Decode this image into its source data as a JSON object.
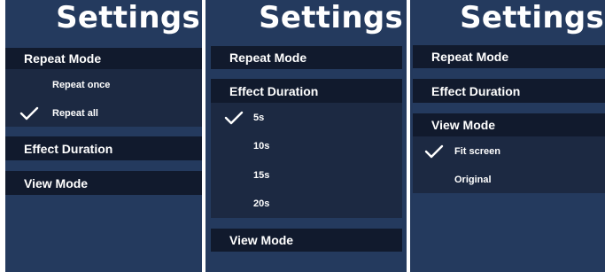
{
  "panels": [
    {
      "title": "Settings",
      "sections": {
        "repeat_mode": "Repeat Mode",
        "effect_duration": "Effect Duration",
        "view_mode": "View Mode"
      },
      "options": [
        {
          "label": "Repeat once",
          "selected": false
        },
        {
          "label": "Repeat all",
          "selected": true
        }
      ]
    },
    {
      "title": "Settings",
      "sections": {
        "repeat_mode": "Repeat Mode",
        "effect_duration": "Effect Duration",
        "view_mode": "View Mode"
      },
      "options": [
        {
          "label": "5s",
          "selected": true
        },
        {
          "label": "10s",
          "selected": false
        },
        {
          "label": "15s",
          "selected": false
        },
        {
          "label": "20s",
          "selected": false
        }
      ]
    },
    {
      "title": "Settings",
      "sections": {
        "repeat_mode": "Repeat Mode",
        "effect_duration": "Effect Duration",
        "view_mode": "View Mode"
      },
      "options": [
        {
          "label": "Fit screen",
          "selected": true
        },
        {
          "label": "Original",
          "selected": false
        }
      ]
    }
  ],
  "icons": {
    "check": "checkmark-icon"
  },
  "colors": {
    "background": "#243a5e",
    "section_header": "#111a2d",
    "options_background": "#1c2942",
    "text": "#ffffff"
  }
}
